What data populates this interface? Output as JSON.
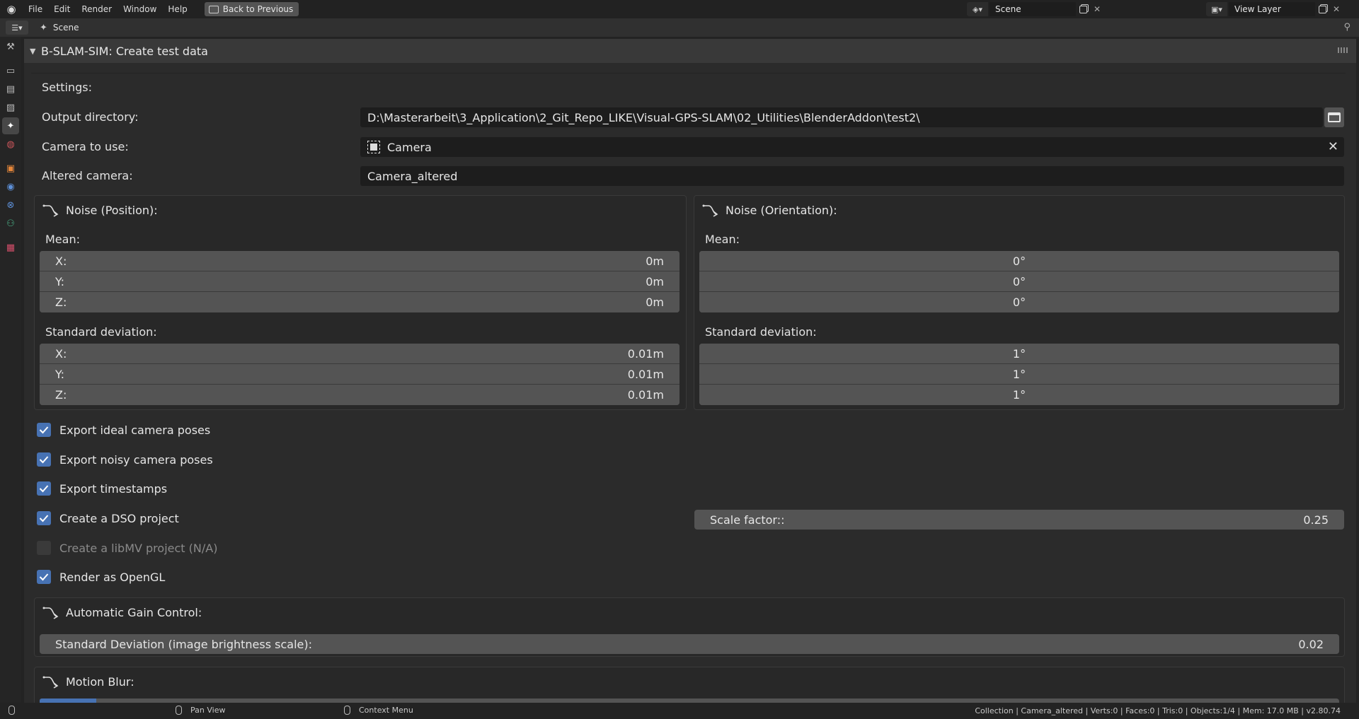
{
  "menubar": {
    "items": [
      "File",
      "Edit",
      "Render",
      "Window",
      "Help"
    ],
    "back_button": "Back to Previous",
    "scene_name": "Scene",
    "view_layer_name": "View Layer"
  },
  "header": {
    "breadcrumb": "Scene"
  },
  "panel": {
    "title": "B-SLAM-SIM: Create test data",
    "settings_label": "Settings:",
    "output_dir_label": "Output directory:",
    "output_dir_value": "D:\\Masterarbeit\\3_Application\\2_Git_Repo_LIKE\\Visual-GPS-SLAM\\02_Utilities\\BlenderAddon\\test2\\",
    "camera_label": "Camera to use:",
    "camera_value": "Camera",
    "altered_label": "Altered camera:",
    "altered_value": "Camera_altered",
    "noise_position": {
      "title": "Noise (Position):",
      "mean_label": "Mean:",
      "mean": [
        {
          "axis": "X:",
          "value": "0m"
        },
        {
          "axis": "Y:",
          "value": "0m"
        },
        {
          "axis": "Z:",
          "value": "0m"
        }
      ],
      "std_label": "Standard deviation:",
      "std": [
        {
          "axis": "X:",
          "value": "0.01m"
        },
        {
          "axis": "Y:",
          "value": "0.01m"
        },
        {
          "axis": "Z:",
          "value": "0.01m"
        }
      ]
    },
    "noise_orientation": {
      "title": "Noise (Orientation):",
      "mean_label": "Mean:",
      "mean": [
        "0°",
        "0°",
        "0°"
      ],
      "std_label": "Standard deviation:",
      "std": [
        "1°",
        "1°",
        "1°"
      ]
    },
    "checks": {
      "ideal": "Export ideal camera poses",
      "noisy": "Export noisy camera poses",
      "timestamps": "Export timestamps",
      "dso": "Create a DSO project",
      "libmv": "Create a libMV project (N/A)",
      "opengl": "Render as OpenGL"
    },
    "scale_factor": {
      "label": "Scale factor::",
      "value": "0.25"
    },
    "agc": {
      "title": "Automatic Gain Control:",
      "std_label": "Standard Deviation (image brightness scale):",
      "std_value": "0.02"
    },
    "motion_blur": {
      "title": "Motion Blur:"
    }
  },
  "statusbar": {
    "pan": "Pan View",
    "context": "Context Menu",
    "info": "Collection | Camera_altered | Verts:0 | Faces:0 | Tris:0 | Objects:1/4 | Mem: 17.0 MB | v2.80.74"
  },
  "colors": {
    "accent": "#4772b3",
    "field": "#545454",
    "background": "#2b2b2b"
  }
}
